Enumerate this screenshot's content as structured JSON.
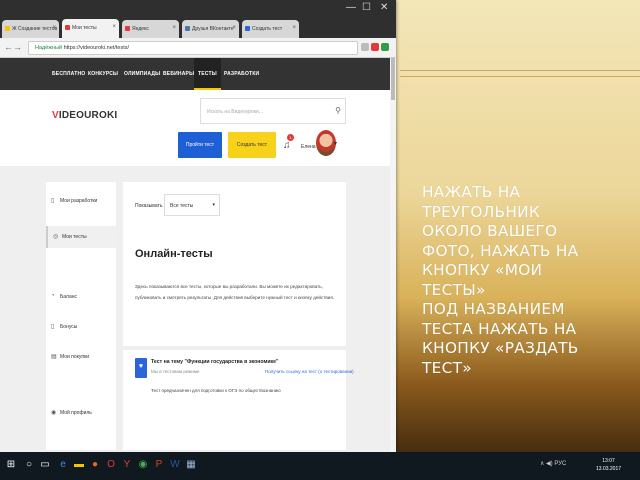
{
  "slide": {
    "lines": [
      "НАЖАТЬ НА",
      "ТРЕУГОЛЬНИК",
      "ОКОЛО ВАШЕГО",
      "ФОТО, НАЖАТЬ НА",
      "КНОПКУ «МОИ",
      "ТЕСТЫ»",
      "ПОД НАЗВАНИЕМ",
      "ТЕСТА НАЖАТЬ НА",
      "КНОПКУ «РАЗДАТЬ",
      "ТЕСТ»"
    ]
  },
  "browser": {
    "tabs": [
      {
        "label": "Ж Создание тестов",
        "color": "#f8c600"
      },
      {
        "label": "Мои тесты",
        "color": "#e23a3a"
      },
      {
        "label": "Яндекс",
        "color": "#e23a3a"
      },
      {
        "label": "Друзья ВКонтакте",
        "color": "#4a76a8"
      },
      {
        "label": "Создать тест",
        "color": "#2b66d9"
      }
    ],
    "window_controls": {
      "min": "—",
      "max": "☐",
      "close": "✕"
    },
    "nav": {
      "back": "←",
      "forward": "→",
      "reload": "↻"
    },
    "url": {
      "secure_label": "Надёжный",
      "address": "https://videouroki.net/tests/"
    },
    "extensions": [
      {
        "icon": "star-icon",
        "color": "#999"
      },
      {
        "icon": "opera-icon",
        "color": "#e23a3a"
      },
      {
        "icon": "ext-icon",
        "color": "#2e9e4a"
      },
      {
        "icon": "menu-icon",
        "color": "#666"
      }
    ]
  },
  "site": {
    "nav_items": [
      "БЕСПЛАТНО",
      "КОНКУРСЫ",
      "ОЛИМПИАДЫ",
      "ВЕБИНАРЫ",
      "ТЕСТЫ",
      "РАЗРАБОТКИ"
    ],
    "logo": {
      "accent": "V",
      "rest": "IDEOUROKI"
    },
    "search_placeholder": "Искать на Видеоуроки...",
    "btn_pass": "Пройти тест",
    "btn_create": "Создать тест",
    "notif_count": "1",
    "user_name": "Елена",
    "sidebar": [
      {
        "label": "Мои разработки",
        "icon": "doc-icon"
      },
      {
        "label": "Мои тесты",
        "icon": "check-icon",
        "active": true
      },
      {
        "label": "Баланс",
        "icon": "coin-icon"
      },
      {
        "label": "Бонусы",
        "icon": "gift-icon"
      },
      {
        "label": "Мои покупки",
        "icon": "cart-icon"
      },
      {
        "label": "Мой профиль",
        "icon": "user-icon"
      }
    ],
    "filter_label": "Показывать",
    "filter_value": "Все тесты",
    "main_title": "Онлайн-тесты",
    "main_desc": "Здесь показываются все тесты, которые вы разработали. Вы можете их редактировать, публиковать и смотреть результаты. Для действия выберите нужный тест и кнопку действия.",
    "card": {
      "title": "Тест на тему \"Функции государства в экономике\"",
      "meta": "Мы в тестовом режиме",
      "link": "Получить ссылку на тест (о тестировании)",
      "text": "Тест предназначен для подготовки к ОГЭ по обществознанию"
    }
  },
  "taskbar": {
    "apps": [
      "windows-icon",
      "search-icon",
      "taskview-icon",
      "edge-icon",
      "explorer-icon",
      "firefox-icon",
      "opera-icon",
      "yandex-icon",
      "chrome-icon",
      "powerpoint-icon",
      "word-icon",
      "paint-icon"
    ],
    "tray": "∧  ◀) РУС",
    "time": "13:07",
    "date": "13.03.2017"
  }
}
